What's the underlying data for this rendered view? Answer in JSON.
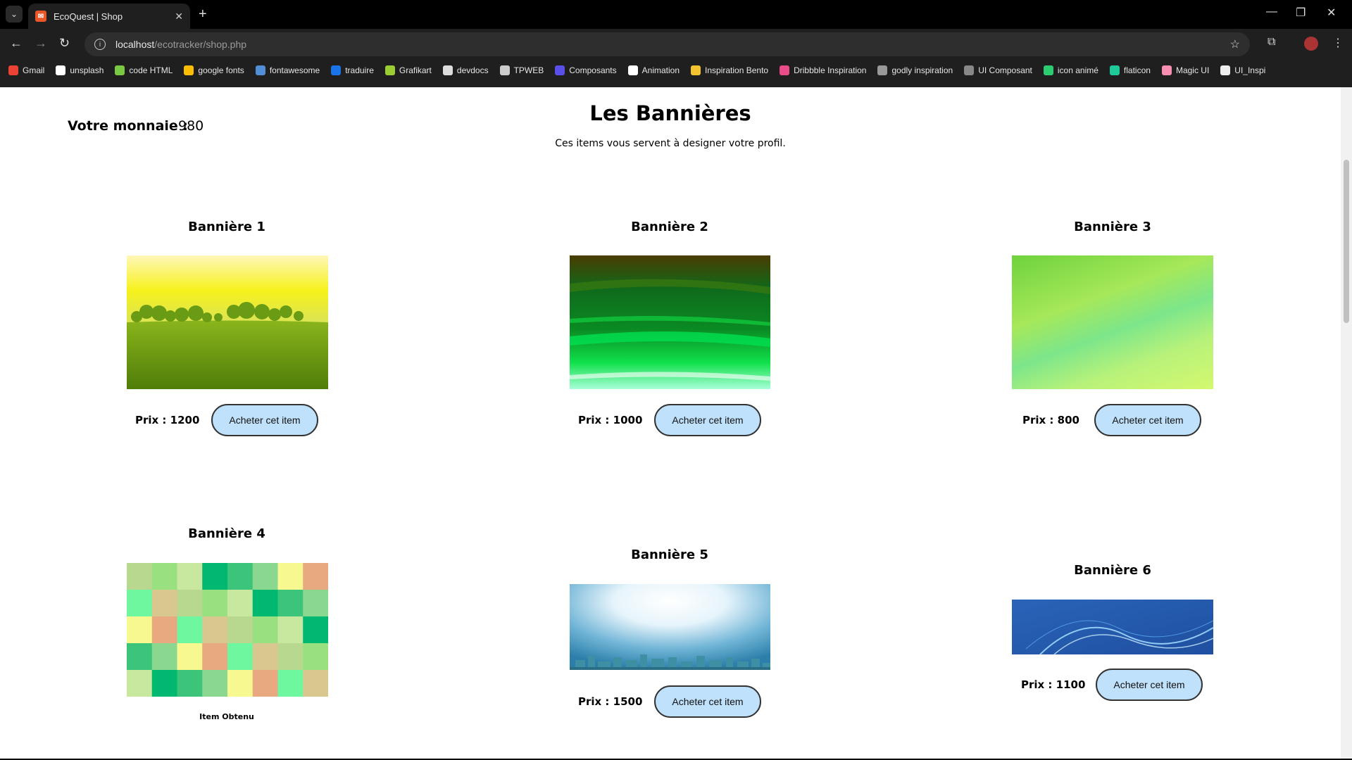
{
  "browser": {
    "tab_title": "EcoQuest | Shop",
    "url_host": "localhost",
    "url_path": "/ecotracker/shop.php",
    "favicon_color": "#e8572a",
    "bookmarks": [
      {
        "label": "Gmail",
        "color": "#ea4335"
      },
      {
        "label": "unsplash",
        "color": "#ffffff"
      },
      {
        "label": "code HTML",
        "color": "#7ac943"
      },
      {
        "label": "google fonts",
        "color": "#fbbc04"
      },
      {
        "label": "fontawesome",
        "color": "#528dd7"
      },
      {
        "label": "traduire",
        "color": "#1a73e8"
      },
      {
        "label": "Grafikart",
        "color": "#9acd32"
      },
      {
        "label": "devdocs",
        "color": "#dddddd"
      },
      {
        "label": "TPWEB",
        "color": "#cccccc"
      },
      {
        "label": "Composants",
        "color": "#5b4fe9"
      },
      {
        "label": "Animation",
        "color": "#ffffff"
      },
      {
        "label": "Inspiration Bento",
        "color": "#f4c430"
      },
      {
        "label": "Dribbble Inspiration",
        "color": "#ea4c89"
      },
      {
        "label": "godly inspiration",
        "color": "#999999"
      },
      {
        "label": "UI Composant",
        "color": "#888888"
      },
      {
        "label": "icon animé",
        "color": "#2ecc71"
      },
      {
        "label": "flaticon",
        "color": "#20c997"
      },
      {
        "label": "Magic UI",
        "color": "#f78fb3"
      },
      {
        "label": "UI_Inspi",
        "color": "#eeeeee"
      }
    ]
  },
  "page": {
    "money_label": "Votre monnaie :",
    "money_value": "980",
    "title": "Les Bannières",
    "subtitle": "Ces items vous servent à designer votre profil.",
    "buy_label": "Acheter cet item",
    "obtained_label": "Item Obtenu",
    "banners": [
      {
        "title": "Bannière 1",
        "price": "Prix : 1200"
      },
      {
        "title": "Bannière 2",
        "price": "Prix : 1000"
      },
      {
        "title": "Bannière 3",
        "price": "Prix : 800"
      },
      {
        "title": "Bannière 4"
      },
      {
        "title": "Bannière 5",
        "price": "Prix : 1500"
      },
      {
        "title": "Bannière 6",
        "price": "Prix : 1100"
      }
    ],
    "button_color": "#bfe1fb"
  }
}
